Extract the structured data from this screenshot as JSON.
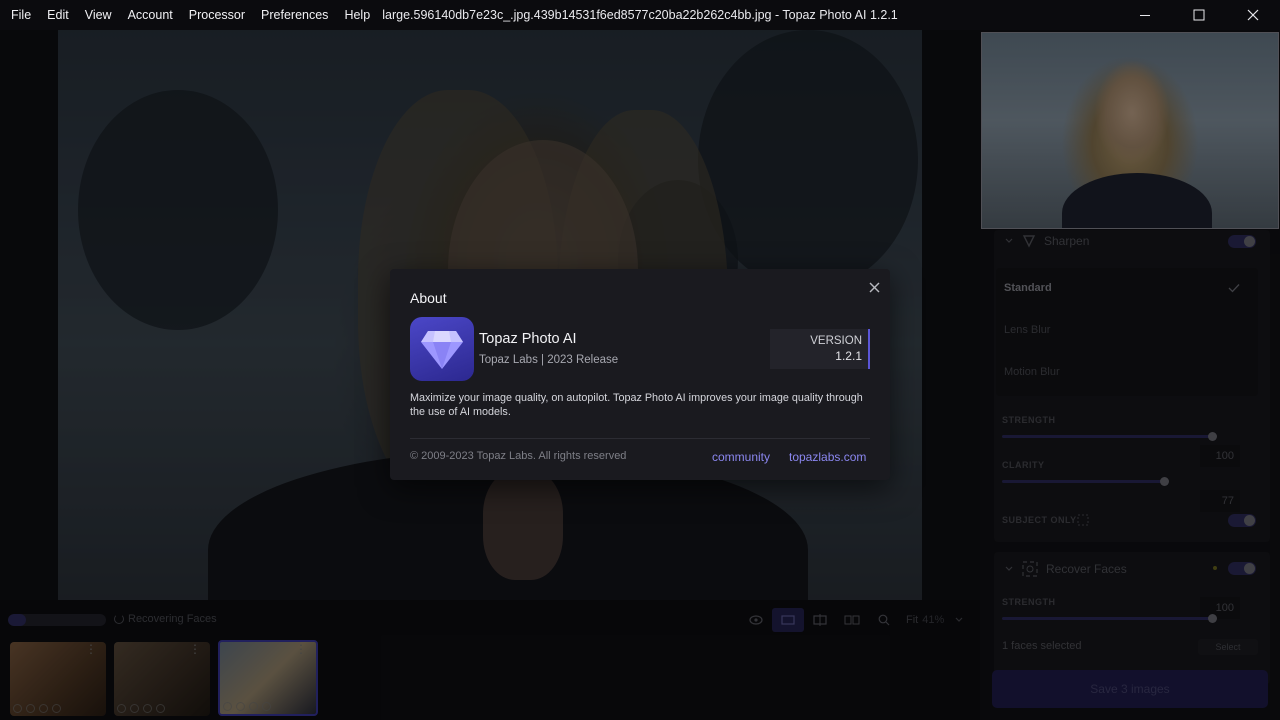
{
  "titlebar": {
    "menu": [
      "File",
      "Edit",
      "View",
      "Account",
      "Processor",
      "Preferences",
      "Help"
    ],
    "window_title": "large.596140db7e23c_.jpg.439b14531f6ed8577c20ba22b262c4bb.jpg - Topaz Photo AI 1.2.1"
  },
  "right_panel": {
    "sharpen": {
      "title": "Sharpen",
      "models": [
        "Standard",
        "Lens Blur",
        "Motion Blur"
      ],
      "selected_model": "Standard",
      "strength_label": "STRENGTH",
      "strength_value": "100",
      "strength": 100,
      "clarity_label": "CLARITY",
      "clarity_value": "77",
      "clarity": 77,
      "subject_only_label": "SUBJECT ONLY"
    },
    "recover_faces": {
      "title": "Recover Faces",
      "strength_label": "STRENGTH",
      "strength_value": "100",
      "strength": 100,
      "faces_selected": "1 faces selected",
      "select_label": "Select"
    },
    "save_label": "Save 3 images"
  },
  "bottom": {
    "status": "Recovering Faces",
    "progress": 0.18,
    "zoom": "Fit",
    "zoom_value": "41%"
  },
  "about": {
    "title": "About",
    "app_name": "Topaz Photo AI",
    "subtitle": "Topaz Labs | 2023 Release",
    "version_label": "VERSION",
    "version": "1.2.1",
    "description": "Maximize your image quality, on autopilot. Topaz Photo AI improves your image quality through the use of AI models.",
    "copyright": "© 2009-2023 Topaz Labs. All rights reserved",
    "links": [
      "community",
      "topazlabs.com"
    ]
  },
  "colors": {
    "accent": "#5b56d8",
    "link": "#8b87f0",
    "dialog_bg": "#1a1a1f"
  }
}
